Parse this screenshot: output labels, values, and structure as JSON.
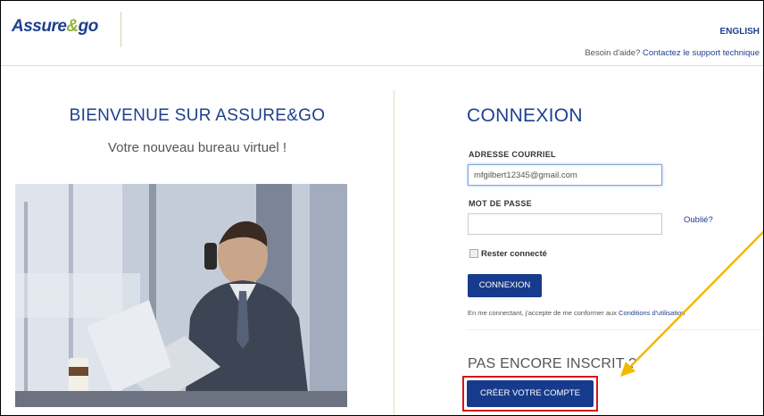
{
  "header": {
    "logo_prefix": "Assure",
    "logo_amp": "&",
    "logo_suffix": "go",
    "language_link": "ENGLISH",
    "help_text": "Besoin d'aide?",
    "help_link": "Contactez le support technique"
  },
  "welcome": {
    "title": "BIENVENUE SUR ASSURE&GO",
    "subtitle": "Votre nouveau bureau virtuel !"
  },
  "login": {
    "title": "CONNEXION",
    "email_label": "ADRESSE COURRIEL",
    "email_value": "mfgilbert12345@gmail.com",
    "password_label": "MOT DE PASSE",
    "password_value": "",
    "forgot_link": "Oublié?",
    "remember_label": "Rester connecté",
    "remember_checked": false,
    "submit_label": "CONNEXION",
    "terms_text": "En me connectant, j'accepte de me conformer aux",
    "terms_link": "Conditions d'utilisation"
  },
  "register": {
    "title": "PAS ENCORE INSCRIT ?",
    "create_button": "CRÉER VOTRE COMPTE"
  },
  "colors": {
    "brand_blue": "#1f3f8f",
    "button_blue": "#173b8c",
    "logo_green": "#8fb53a",
    "highlight_red": "#d6141c",
    "arrow_yellow": "#f3b800"
  }
}
